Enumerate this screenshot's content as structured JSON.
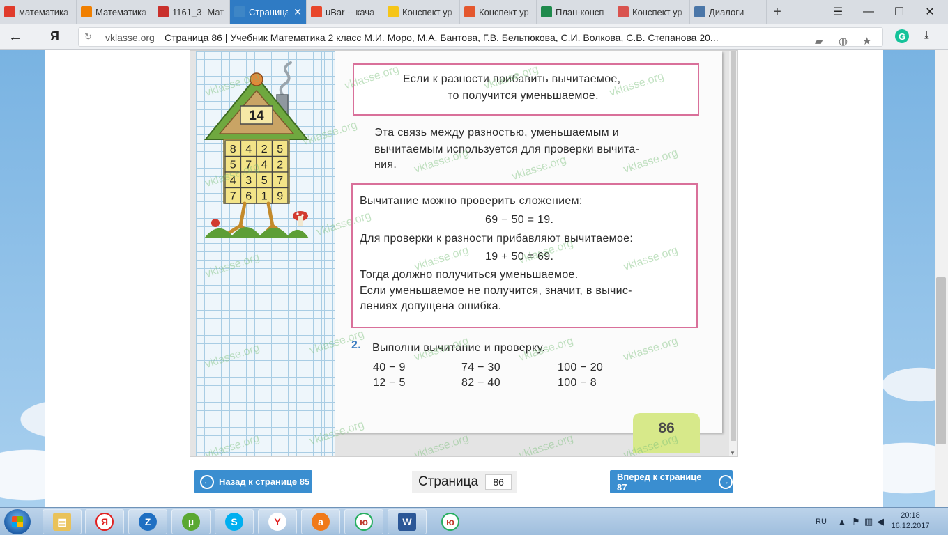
{
  "tabs": [
    {
      "label": "математика",
      "icon": "yandex-icon",
      "color": "#e03b2c"
    },
    {
      "label": "Математика",
      "icon": "ab-icon",
      "color": "#f07f00"
    },
    {
      "label": "1161_3- Мат",
      "icon": "pdf-icon",
      "color": "#c9302c"
    },
    {
      "label": "Страница",
      "icon": "vklasse-icon",
      "color": "#3e86c6",
      "active": true
    },
    {
      "label": "uBar -- кача",
      "icon": "ubar-icon",
      "color": "#e8472b"
    },
    {
      "label": "Конспект ур",
      "icon": "doc-icon",
      "color": "#f5c518"
    },
    {
      "label": "Конспект ур",
      "icon": "video-icon",
      "color": "#e4572e"
    },
    {
      "label": "План-консп",
      "icon": "check-icon",
      "color": "#1f8a4c"
    },
    {
      "label": "Конспект ур",
      "icon": "books-icon",
      "color": "#d9534f"
    },
    {
      "label": "Диалоги",
      "icon": "chat-icon",
      "color": "#4a76a8"
    }
  ],
  "address": {
    "domain": "vklasse.org",
    "title": "Страница 86 | Учебник Математика 2 класс М.И. Моро, М.А. Бантова, Г.В. Бельтюкова, С.И. Волкова, С.В. Степанова 20..."
  },
  "book": {
    "house_number": "14",
    "house_grid": [
      [
        "8",
        "4",
        "2",
        "5"
      ],
      [
        "5",
        "7",
        "4",
        "2"
      ],
      [
        "4",
        "3",
        "5",
        "7"
      ],
      [
        "7",
        "6",
        "1",
        "9"
      ]
    ],
    "rule1_line1": "Если к разности прибавить вычитаемое,",
    "rule1_line2": "то получится уменьшаемое.",
    "para_line1": "Эта связь между разностью, уменьшаемым и",
    "para_line2": "вычитаемым используется для проверки вычита-",
    "para_line3": "ния.",
    "rule2_line1": "Вычитание можно проверить сложением:",
    "rule2_eq1": "69 − 50 = 19.",
    "rule2_line2": "Для проверки к разности прибавляют вычитаемое:",
    "rule2_eq2": "19 + 50 = 69.",
    "rule2_line3": "Тогда должно получиться уменьшаемое.",
    "rule2_line4": "Если уменьшаемое не получится, значит, в вычис-",
    "rule2_line5": "лениях допущена ошибка.",
    "task_number": "2.",
    "task_text": "Выполни вычитание и проверку.",
    "exercises": [
      "40 − 9",
      "12 − 5",
      "74 − 30",
      "82 − 40",
      "100 − 20",
      "100 − 8"
    ],
    "page_number": "86",
    "watermark": "vklasse.org"
  },
  "nav": {
    "prev_label": "Назад к странице 85",
    "next_label": "Вперед к странице 87",
    "page_label": "Страница",
    "page_value": "86"
  },
  "taskbar": {
    "lang": "RU",
    "time": "20:18",
    "date": "16.12.2017"
  }
}
